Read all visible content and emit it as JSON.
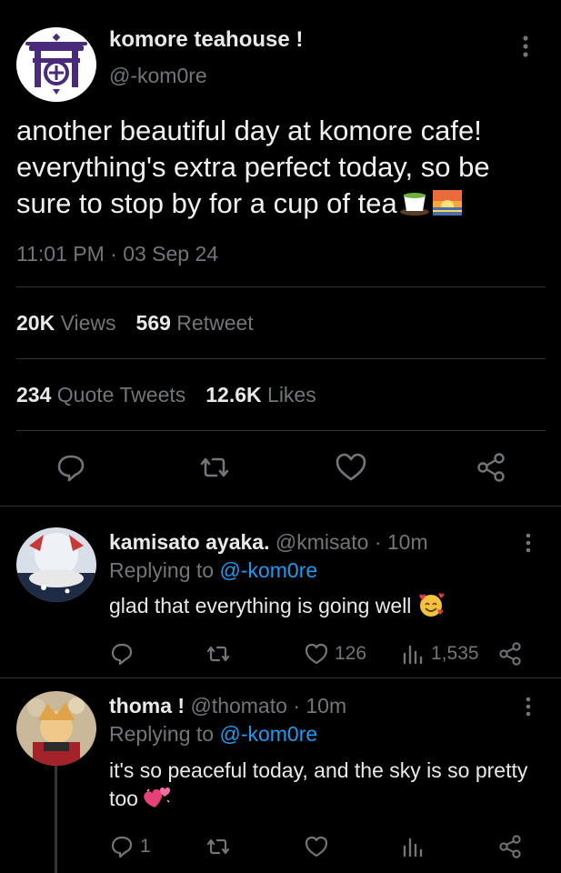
{
  "main_tweet": {
    "author_name": "komore teahouse !",
    "author_handle": "@-kom0re",
    "text": "another beautiful day at komore cafe! everything's extra perfect today, so be sure to stop by for a cup of tea",
    "emojis": [
      "tea-cup-emoji",
      "sunrise-emoji"
    ],
    "time": "11:01 PM",
    "separator": "·",
    "date": "03 Sep 24",
    "stats": {
      "views_count": "20K",
      "views_label": "Views",
      "retweet_count": "569",
      "retweet_label": "Retweet",
      "quote_count": "234",
      "quote_label": "Quote Tweets",
      "likes_count": "12.6K",
      "likes_label": "Likes"
    },
    "actions": [
      "reply-icon",
      "retweet-icon",
      "heart-icon",
      "share-icon"
    ]
  },
  "replies": [
    {
      "name": "kamisato ayaka.",
      "handle": "@kmisato",
      "sep": "·",
      "time": "10m",
      "replying_prefix": "Replying to",
      "replying_to": "@-kom0re",
      "text": "glad that everything is going well",
      "emoji": "smiling-face-with-hearts-emoji",
      "counts": {
        "reply": "",
        "retweet": "",
        "likes": "126",
        "views": "1,535"
      }
    },
    {
      "name": "thoma !",
      "handle": "@thomato",
      "sep": "·",
      "time": "10m",
      "replying_prefix": "Replying to",
      "replying_to": "@-kom0re",
      "text": "it's so peaceful today, and the sky is so pretty too",
      "emoji": "revolving-hearts-emoji",
      "counts": {
        "reply": "1",
        "retweet": "",
        "likes": "",
        "views": ""
      }
    }
  ],
  "colors": {
    "background": "#000000",
    "text": "#e7e9ea",
    "muted": "#71767b",
    "link": "#1d9bf0",
    "divider": "#2f3336",
    "brand_purple": "#4a2a7a"
  }
}
